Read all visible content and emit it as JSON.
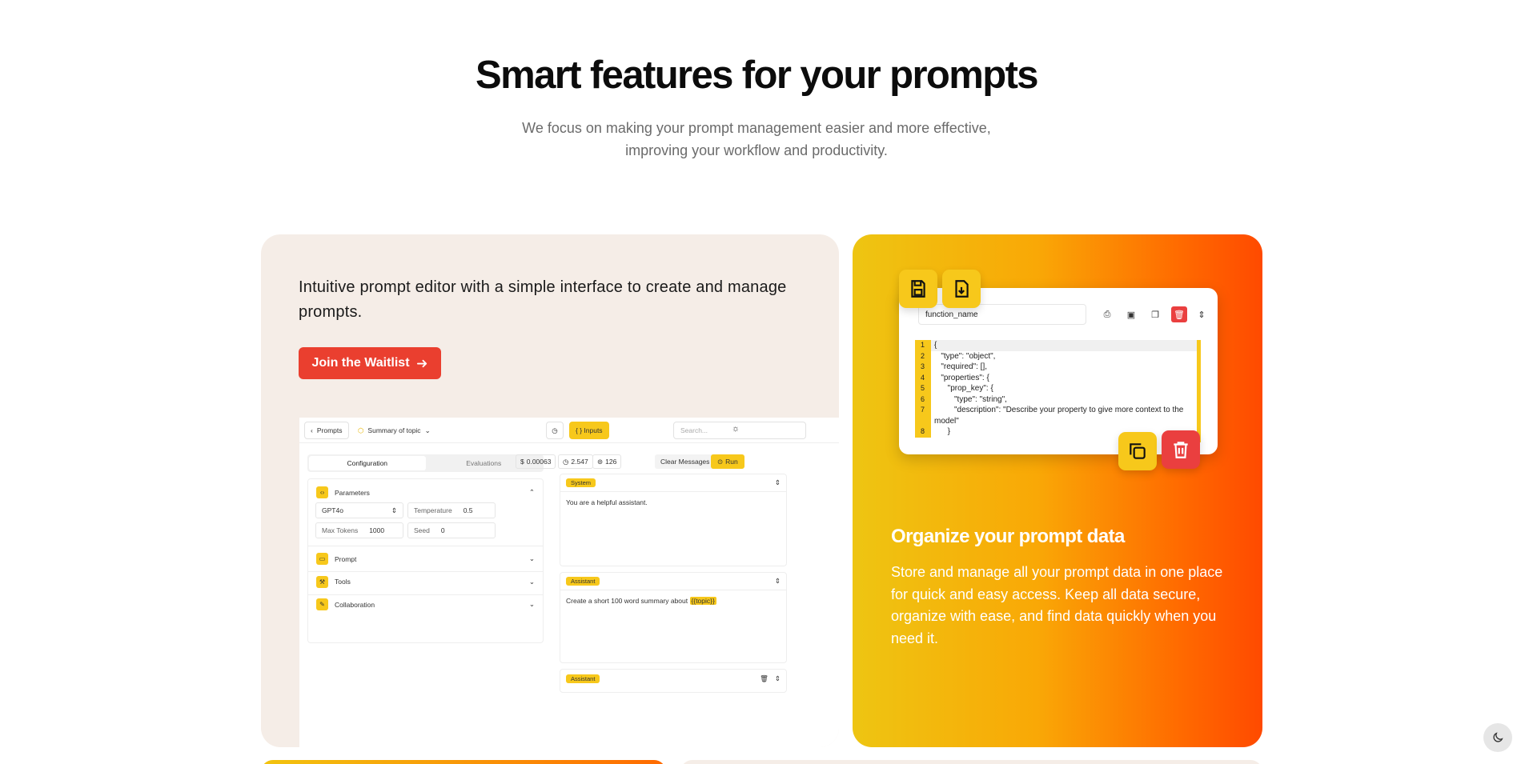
{
  "hero": {
    "title": "Smart features for your prompts",
    "subtitle": "We focus on making your prompt management easier and more effective, improving your workflow and productivity."
  },
  "editor_card": {
    "description": "Intuitive prompt editor with a simple interface to create and manage prompts.",
    "cta_label": "Join the Waitlist",
    "mock": {
      "back_label": "Prompts",
      "prompt_name": "Summary of topic",
      "inputs_label": "{ } Inputs",
      "search_placeholder": "Search...",
      "tab_config": "Configuration",
      "tab_evals": "Evaluations",
      "parameters_label": "Parameters",
      "model_value": "GPT4o",
      "temperature_label": "Temperature",
      "temperature_value": "0.5",
      "max_tokens_label": "Max Tokens",
      "max_tokens_value": "1000",
      "seed_label": "Seed",
      "seed_value": "0",
      "prompt_label": "Prompt",
      "tools_label": "Tools",
      "collab_label": "Collaboration",
      "cost": "0.00063",
      "latency": "2.547",
      "tokens": "126",
      "clear_label": "Clear Messages",
      "run_label": "Run",
      "system_tag": "System",
      "system_text": "You are a helpful assistant.",
      "assistant_tag": "Assistant",
      "assistant_text": "Create a short 100 word summary about",
      "assistant_var": "{{topic}}",
      "assistant_tag_2": "Assistant"
    }
  },
  "data_card": {
    "function_name": "function_name",
    "code_lines": [
      {
        "n": "1",
        "t": "{"
      },
      {
        "n": "2",
        "t": "   \"type\": \"object\","
      },
      {
        "n": "3",
        "t": "   \"required\": [],"
      },
      {
        "n": "4",
        "t": "   \"properties\": {"
      },
      {
        "n": "5",
        "t": "      \"prop_key\": {"
      },
      {
        "n": "6",
        "t": "         \"type\": \"string\","
      },
      {
        "n": "7",
        "t": "         \"description\": \"Describe your property to give more context to the"
      },
      {
        "n": "",
        "t": "model\""
      },
      {
        "n": "8",
        "t": "      }"
      }
    ],
    "title": "Organize your prompt data",
    "text": "Store and manage all your prompt data in one place for quick and easy access. Keep all data secure, organize with ease, and find data quickly when you need it."
  },
  "colors": {
    "accent_red": "#ea3f2f",
    "accent_yellow": "#f7c81b",
    "card_beige": "#f5ede7",
    "gradient_end": "#ff4a00"
  }
}
